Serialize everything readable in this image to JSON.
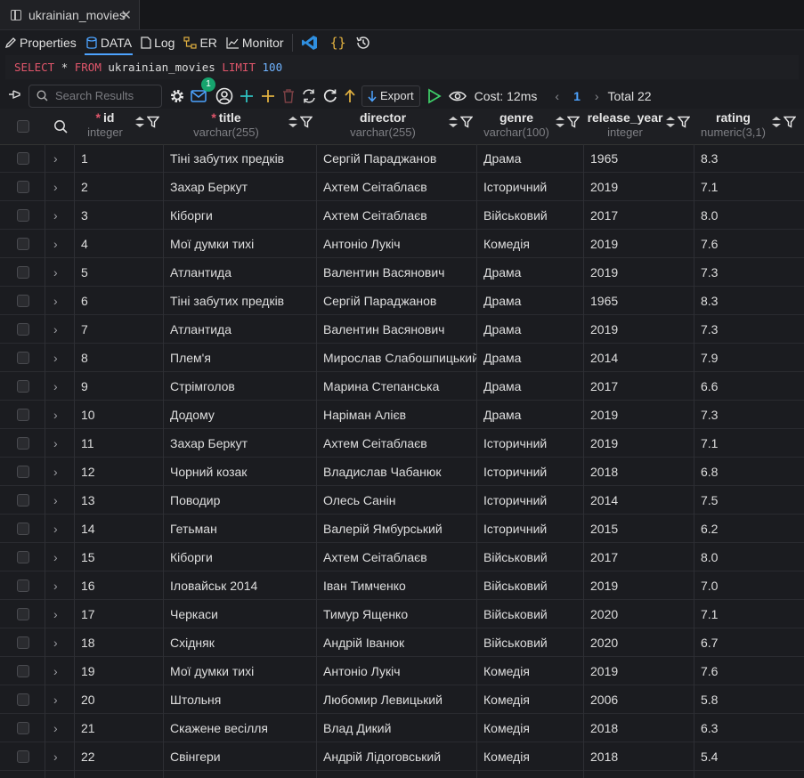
{
  "tab": {
    "title": "ukrainian_movies"
  },
  "toolbar": {
    "properties": "Properties",
    "data": "DATA",
    "log": "Log",
    "er": "ER",
    "monitor": "Monitor"
  },
  "sql": {
    "select": "SELECT",
    "star": "*",
    "from": "FROM",
    "table": "ukrainian_movies",
    "limit": "LIMIT",
    "limit_value": "100"
  },
  "actions": {
    "search_placeholder": "Search Results",
    "notification_count": "1",
    "export_label": "Export",
    "cost": "Cost: 12ms",
    "page": "1",
    "total": "Total 22"
  },
  "columns": [
    {
      "name": "id",
      "type": "integer",
      "required": "*"
    },
    {
      "name": "title",
      "type": "varchar(255)",
      "required": "*"
    },
    {
      "name": "director",
      "type": "varchar(255)",
      "required": ""
    },
    {
      "name": "genre",
      "type": "varchar(100)",
      "required": ""
    },
    {
      "name": "release_year",
      "type": "integer",
      "required": ""
    },
    {
      "name": "rating",
      "type": "numeric(3,1)",
      "required": ""
    }
  ],
  "rows": [
    [
      "1",
      "Тіні забутих предків",
      "Сергій Параджанов",
      "Драма",
      "1965",
      "8.3"
    ],
    [
      "2",
      "Захар Беркут",
      "Ахтем Сеітаблаєв",
      "Історичний",
      "2019",
      "7.1"
    ],
    [
      "3",
      "Кіборги",
      "Ахтем Сеітаблаєв",
      "Військовий",
      "2017",
      "8.0"
    ],
    [
      "4",
      "Мої думки тихі",
      "Антоніо Лукіч",
      "Комедія",
      "2019",
      "7.6"
    ],
    [
      "5",
      "Атлантида",
      "Валентин Васянович",
      "Драма",
      "2019",
      "7.3"
    ],
    [
      "6",
      "Тіні забутих предків",
      "Сергій Параджанов",
      "Драма",
      "1965",
      "8.3"
    ],
    [
      "7",
      "Атлантида",
      "Валентин Васянович",
      "Драма",
      "2019",
      "7.3"
    ],
    [
      "8",
      "Плем'я",
      "Мирослав Слабошпицький",
      "Драма",
      "2014",
      "7.9"
    ],
    [
      "9",
      "Стрімголов",
      "Марина Степанська",
      "Драма",
      "2017",
      "6.6"
    ],
    [
      "10",
      "Додому",
      "Наріман Алієв",
      "Драма",
      "2019",
      "7.3"
    ],
    [
      "11",
      "Захар Беркут",
      "Ахтем Сеітаблаєв",
      "Історичний",
      "2019",
      "7.1"
    ],
    [
      "12",
      "Чорний козак",
      "Владислав Чабанюк",
      "Історичний",
      "2018",
      "6.8"
    ],
    [
      "13",
      "Поводир",
      "Олесь Санін",
      "Історичний",
      "2014",
      "7.5"
    ],
    [
      "14",
      "Гетьман",
      "Валерій Ямбурський",
      "Історичний",
      "2015",
      "6.2"
    ],
    [
      "15",
      "Кіборги",
      "Ахтем Сеітаблаєв",
      "Військовий",
      "2017",
      "8.0"
    ],
    [
      "16",
      "Іловайськ 2014",
      "Іван Тимченко",
      "Військовий",
      "2019",
      "7.0"
    ],
    [
      "17",
      "Черкаси",
      "Тимур Ященко",
      "Військовий",
      "2020",
      "7.1"
    ],
    [
      "18",
      "Східняк",
      "Андрій Іванюк",
      "Військовий",
      "2020",
      "6.7"
    ],
    [
      "19",
      "Мої думки тихі",
      "Антоніо Лукіч",
      "Комедія",
      "2019",
      "7.6"
    ],
    [
      "20",
      "Штольня",
      "Любомир Левицький",
      "Комедія",
      "2006",
      "5.8"
    ],
    [
      "21",
      "Скажене весілля",
      "Влад Дикий",
      "Комедія",
      "2018",
      "6.3"
    ],
    [
      "22",
      "Свінгери",
      "Андрій Лідоговський",
      "Комедія",
      "2018",
      "5.4"
    ]
  ]
}
